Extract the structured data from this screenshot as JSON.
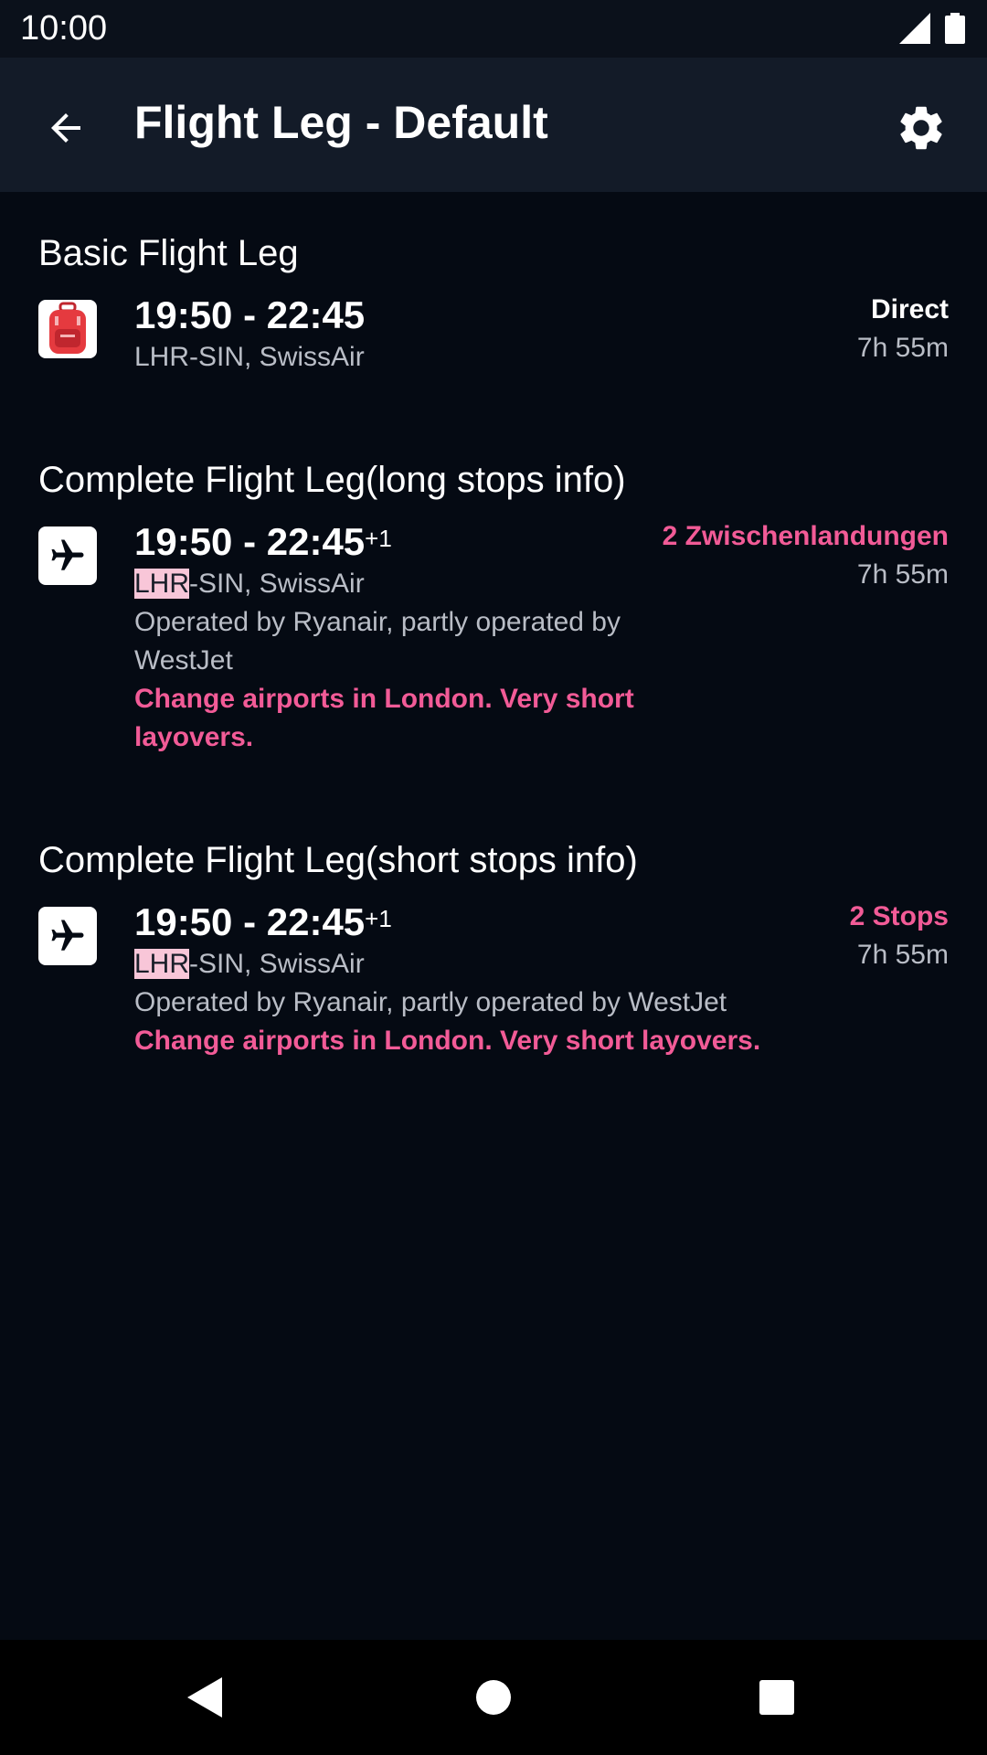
{
  "status_bar": {
    "time": "10:00",
    "icons": [
      "signal-icon",
      "battery-icon"
    ]
  },
  "app_bar": {
    "title": "Flight Leg - Default",
    "back_icon": "arrow-back-icon",
    "settings_icon": "gear-icon"
  },
  "sections": [
    {
      "title": "Basic Flight Leg",
      "icon": "backpack-icon",
      "times": "19:50 - 22:45",
      "day_offset": "",
      "route_origin": "LHR",
      "route_rest": "-SIN, SwissAir",
      "operated_by": "",
      "warning": "",
      "stops": "Direct",
      "duration": "7h 55m"
    },
    {
      "title": "Complete Flight Leg(long stops info)",
      "icon": "airplane-icon",
      "times": "19:50 - 22:45",
      "day_offset": "+1",
      "route_origin": "LHR",
      "route_rest": "-SIN, SwissAir",
      "operated_by": "Operated by Ryanair, partly operated by WestJet",
      "warning": "Change airports in London. Very short layovers.",
      "stops": "2 Zwischenlandungen",
      "duration": "7h 55m"
    },
    {
      "title": "Complete Flight Leg(short stops info)",
      "icon": "airplane-icon",
      "times": "19:50 - 22:45",
      "day_offset": "+1",
      "route_origin": "LHR",
      "route_rest": "-SIN, SwissAir",
      "operated_by": "Operated by Ryanair, partly operated by WestJet",
      "warning": "Change airports in London. Very short layovers.",
      "stops": "2 Stops",
      "duration": "7h 55m"
    }
  ],
  "colors": {
    "background": "#050a13",
    "app_bar": "#131b28",
    "accent_pink": "#f25b97",
    "highlight": "#f8c6d8",
    "secondary_text": "#b9bdc6"
  },
  "nav_bar": {
    "icons": [
      "nav-back-icon",
      "nav-home-icon",
      "nav-recents-icon"
    ]
  }
}
